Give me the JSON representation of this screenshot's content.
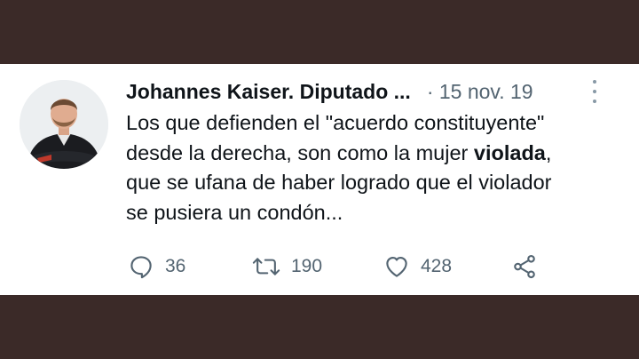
{
  "tweet": {
    "author": "Johannes Kaiser. Diputado ...",
    "separator": "·",
    "date": "15 nov. 19",
    "text_lines": [
      "Los que defienden el \"acuerdo constituyente\"",
      "desde la derecha, son como la mujer ",
      "violada",
      ",",
      "que se ufana de haber logrado que el violador",
      "se pusiera un condón..."
    ],
    "reply_count": "36",
    "retweet_count": "190",
    "like_count": "428"
  },
  "icons": {
    "reply": "reply-icon",
    "retweet": "retweet-icon",
    "like": "heart-icon",
    "share": "share-icon",
    "more": "more-options-icon"
  },
  "colors": {
    "background_band": "#3b2a28",
    "text_primary": "#0f1419",
    "text_secondary": "#536471"
  }
}
